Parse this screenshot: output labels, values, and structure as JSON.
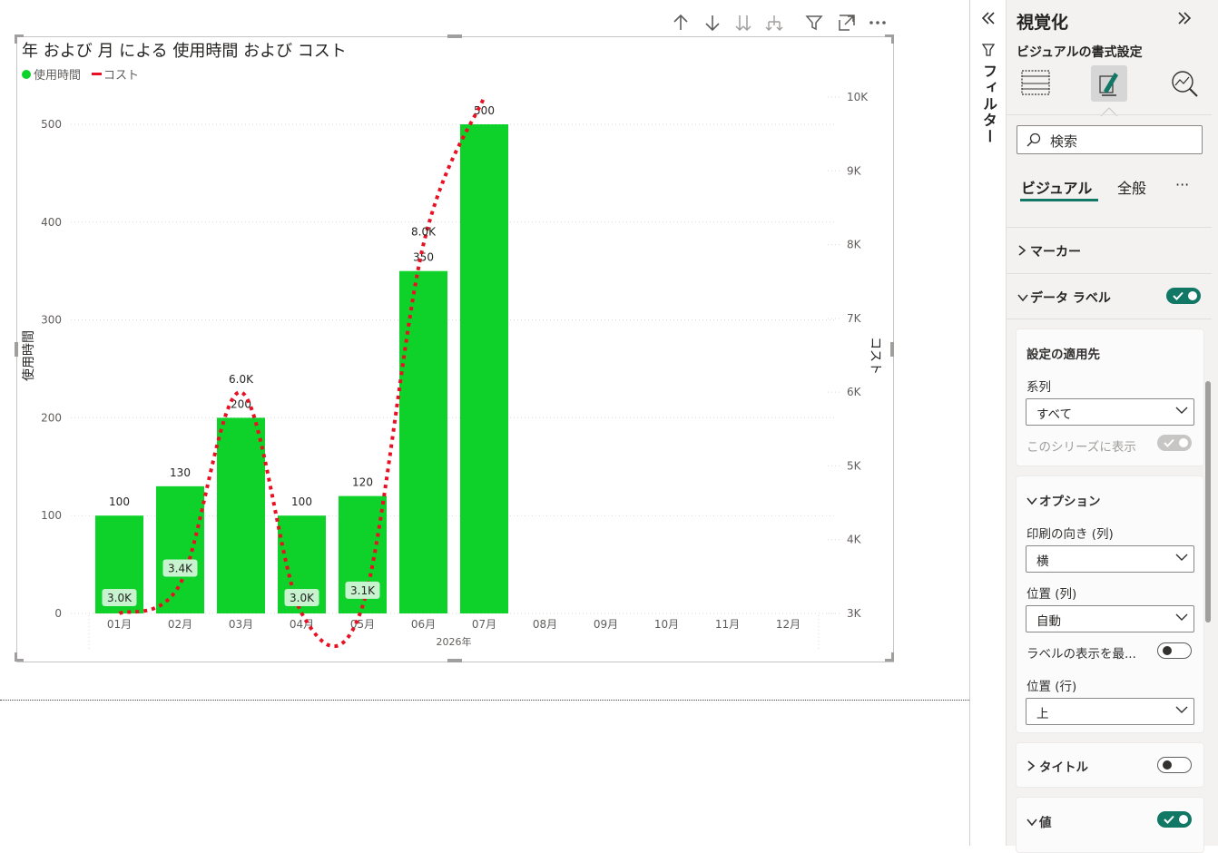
{
  "visual_header": {
    "icons": [
      "arrow-up-icon",
      "arrow-down-icon",
      "double-arrow-down-icon",
      "expand-hierarchy-icon",
      "filter-icon",
      "focus-mode-icon",
      "more-options-icon"
    ]
  },
  "chart_data": {
    "type": "combo-bar-line",
    "title": "年 および 月 による 使用時間 および コスト",
    "legend": [
      {
        "name": "使用時間",
        "color": "#0ed22a",
        "marker": "circle"
      },
      {
        "name": "コスト",
        "color": "#e81123",
        "marker": "line"
      }
    ],
    "categories": [
      "01月",
      "02月",
      "03月",
      "04月",
      "05月",
      "06月",
      "07月",
      "08月",
      "09月",
      "10月",
      "11月",
      "12月"
    ],
    "x_group_label": "2026年",
    "series": [
      {
        "name": "使用時間",
        "type": "bar",
        "axis": "left",
        "values": [
          100,
          130,
          200,
          100,
          120,
          350,
          500,
          null,
          null,
          null,
          null,
          null
        ],
        "labels": [
          "100",
          "130",
          "200",
          "100",
          "120",
          "350",
          "500"
        ]
      },
      {
        "name": "コスト",
        "type": "line",
        "axis": "right",
        "style": "dotted",
        "values": [
          3000,
          3400,
          6000,
          3000,
          3100,
          8000,
          10000,
          null,
          null,
          null,
          null,
          null
        ],
        "labels": [
          "3.0K",
          "3.4K",
          "6.0K",
          "3.0K",
          "3.1K",
          "8.0K",
          ""
        ]
      }
    ],
    "y_left": {
      "label": "使用時間",
      "ticks": [
        "0",
        "100",
        "200",
        "300",
        "400",
        "500"
      ],
      "range": [
        0,
        500
      ]
    },
    "y_right": {
      "label": "コスト",
      "ticks": [
        "3K",
        "4K",
        "5K",
        "6K",
        "7K",
        "8K",
        "9K",
        "10K"
      ],
      "range": [
        3000,
        10000
      ]
    },
    "grid": true,
    "legend_position": "top-left"
  },
  "filter_pane": {
    "label": "フィルター"
  },
  "viz_pane": {
    "title": "視覚化",
    "subtitle": "ビジュアルの書式設定",
    "search_placeholder": "検索",
    "tabs": [
      "ビジュアル",
      "全般"
    ],
    "more": "···",
    "sections": {
      "marker": "マーカー",
      "data_labels": "データ ラベル",
      "apply_settings": "設定の適用先",
      "series_label": "系列",
      "series_value": "すべて",
      "show_for_series": "このシリーズに表示",
      "options": "オプション",
      "orientation_label": "印刷の向き (列)",
      "orientation_value": "横",
      "position_col_label": "位置 (列)",
      "position_col_value": "自動",
      "overflow_label": "ラベルの表示を最...",
      "position_row_label": "位置 (行)",
      "position_row_value": "上",
      "title": "タイトル",
      "value": "値"
    },
    "toggles": {
      "data_labels": true,
      "show_for_series": true,
      "overflow": false,
      "title": false,
      "value": true
    }
  }
}
